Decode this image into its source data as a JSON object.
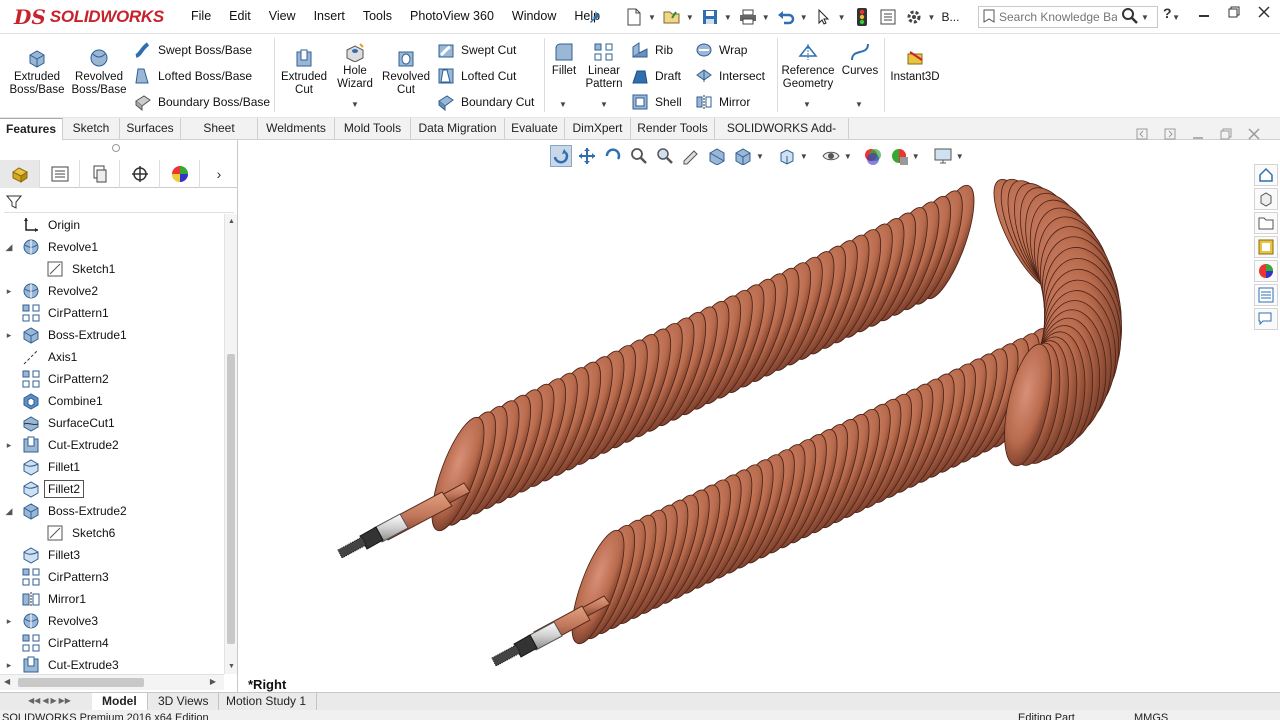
{
  "app": {
    "brand_prefix": "DS",
    "brand": "SOLIDWORKS"
  },
  "menu": [
    "File",
    "Edit",
    "View",
    "Insert",
    "Tools",
    "PhotoView 360",
    "Window",
    "Help"
  ],
  "search": {
    "placeholder": "Search Knowledge Base",
    "truncated_label": "B..."
  },
  "ribbon": {
    "extruded_boss": "Extruded Boss/Base",
    "revolved_boss": "Revolved Boss/Base",
    "swept_boss": "Swept Boss/Base",
    "lofted_boss": "Lofted Boss/Base",
    "boundary_boss": "Boundary Boss/Base",
    "extruded_cut": "Extruded Cut",
    "hole_wizard": "Hole Wizard",
    "revolved_cut": "Revolved Cut",
    "swept_cut": "Swept Cut",
    "lofted_cut": "Lofted Cut",
    "boundary_cut": "Boundary Cut",
    "fillet": "Fillet",
    "linear_pattern": "Linear Pattern",
    "rib": "Rib",
    "draft": "Draft",
    "shell": "Shell",
    "wrap": "Wrap",
    "intersect": "Intersect",
    "mirror": "Mirror",
    "reference_geometry": "Reference Geometry",
    "curves": "Curves",
    "instant3d": "Instant3D"
  },
  "tabs": [
    "Features",
    "Sketch",
    "Surfaces",
    "Sheet Metal",
    "Weldments",
    "Mold Tools",
    "Data Migration",
    "Evaluate",
    "DimXpert",
    "Render Tools",
    "SOLIDWORKS Add-Ins"
  ],
  "active_tab": "Features",
  "tree": [
    {
      "label": "Origin",
      "icon": "origin-icon",
      "expand": ""
    },
    {
      "label": "Revolve1",
      "icon": "revolve-icon",
      "expand": "open"
    },
    {
      "label": "Sketch1",
      "icon": "sketch-icon",
      "expand": "",
      "child": true
    },
    {
      "label": "Revolve2",
      "icon": "revolve-icon",
      "expand": "closed"
    },
    {
      "label": "CirPattern1",
      "icon": "circular-pattern-icon",
      "expand": ""
    },
    {
      "label": "Boss-Extrude1",
      "icon": "extrude-icon",
      "expand": "closed"
    },
    {
      "label": "Axis1",
      "icon": "axis-icon",
      "expand": ""
    },
    {
      "label": "CirPattern2",
      "icon": "circular-pattern-icon",
      "expand": ""
    },
    {
      "label": "Combine1",
      "icon": "combine-icon",
      "expand": ""
    },
    {
      "label": "SurfaceCut1",
      "icon": "surface-cut-icon",
      "expand": ""
    },
    {
      "label": "Cut-Extrude2",
      "icon": "cut-extrude-icon",
      "expand": "closed"
    },
    {
      "label": "Fillet1",
      "icon": "fillet-icon",
      "expand": ""
    },
    {
      "label": "Fillet2",
      "icon": "fillet-icon",
      "expand": "",
      "selected": true
    },
    {
      "label": "Boss-Extrude2",
      "icon": "extrude-icon",
      "expand": "open"
    },
    {
      "label": "Sketch6",
      "icon": "sketch-icon",
      "expand": "",
      "child": true
    },
    {
      "label": "Fillet3",
      "icon": "fillet-icon",
      "expand": ""
    },
    {
      "label": "CirPattern3",
      "icon": "circular-pattern-icon",
      "expand": ""
    },
    {
      "label": "Mirror1",
      "icon": "mirror-icon",
      "expand": ""
    },
    {
      "label": "Revolve3",
      "icon": "revolve-icon",
      "expand": "closed"
    },
    {
      "label": "CirPattern4",
      "icon": "circular-pattern-icon",
      "expand": ""
    },
    {
      "label": "Cut-Extrude3",
      "icon": "cut-extrude-icon",
      "expand": "closed"
    }
  ],
  "view_label": "*Right",
  "bottom_tabs": [
    "Model",
    "3D Views",
    "Motion Study 1"
  ],
  "active_bottom_tab": "Model",
  "status": {
    "left": "SOLIDWORKS Premium 2016 x64 Edition",
    "editing": "Editing Part",
    "units": "MMGS"
  },
  "colors": {
    "brand_red": "#c8232c",
    "copper": "#b86a4c",
    "copper_dark": "#6b3424",
    "accent_blue": "#2f6fb0"
  }
}
